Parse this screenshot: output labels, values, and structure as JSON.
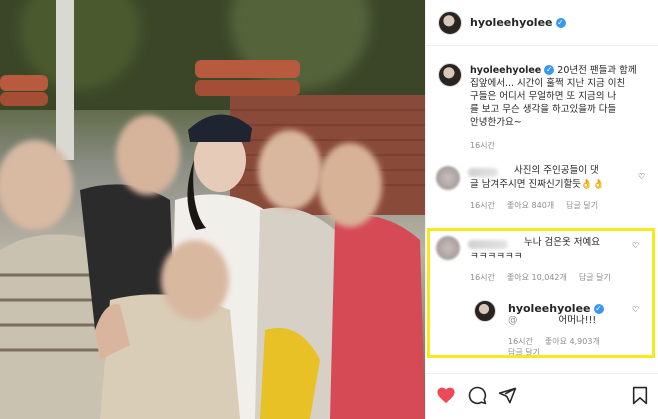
{
  "post": {
    "username": "hyoleehyolee",
    "caption_lines": [
      "20년전 팬들과 함께",
      "집앞에서... 시간이 훌쩍 지난 지금 이친",
      "구들은 어디서 무얼하면 또 지금의 나",
      "를 보고 무슨 생각을 하고있을까 다들",
      "안녕한가요~"
    ],
    "caption_time": "16시간",
    "comments": [
      {
        "text_lines": [
          "사진의 주인공들이 댓",
          "글 남겨주시면 진짜신기할듯👌👌"
        ],
        "time": "16시간",
        "likes": "좋아요 840개",
        "reply": "답글 달기"
      },
      {
        "text_lines": [
          "누나 검은옷 저예요",
          "ㅋㅋㅋㅋㅋㅋ"
        ],
        "time": "16시간",
        "likes": "좋아요 10,042개",
        "reply": "답글 달기",
        "highlighted": true
      }
    ],
    "reply": {
      "username": "hyoleehyolee",
      "mention": "@",
      "text": "어머나!!!",
      "time": "16시간",
      "likes": "좋아요 4,903개",
      "reply": "답글 달기"
    }
  },
  "actions": {
    "icons": [
      "heart-icon",
      "comment-icon",
      "share-icon",
      "bookmark-icon"
    ],
    "like_color": "#ed4956"
  },
  "colors": {
    "highlight": "#f6ea1f",
    "verified": "#3897f0"
  }
}
